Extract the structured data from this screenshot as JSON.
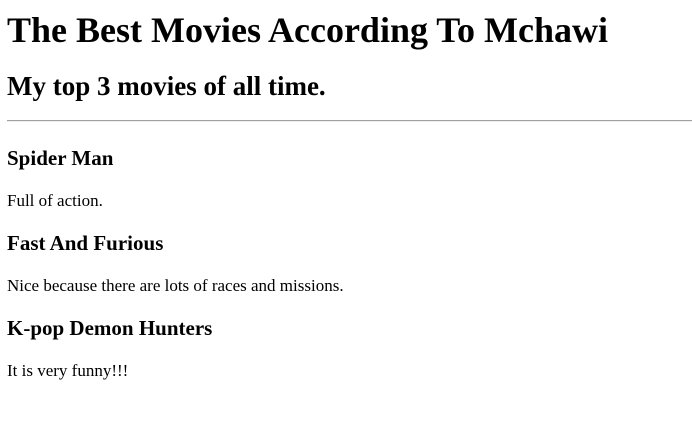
{
  "page": {
    "title": "The Best Movies According To Mchawi",
    "subtitle": "My top 3 movies of all time."
  },
  "movies": [
    {
      "title": "Spider Man",
      "description": "Full of action."
    },
    {
      "title": "Fast And Furious",
      "description": "Nice because there are lots of races and missions."
    },
    {
      "title": "K-pop Demon Hunters",
      "description": "It is very funny!!!"
    }
  ]
}
